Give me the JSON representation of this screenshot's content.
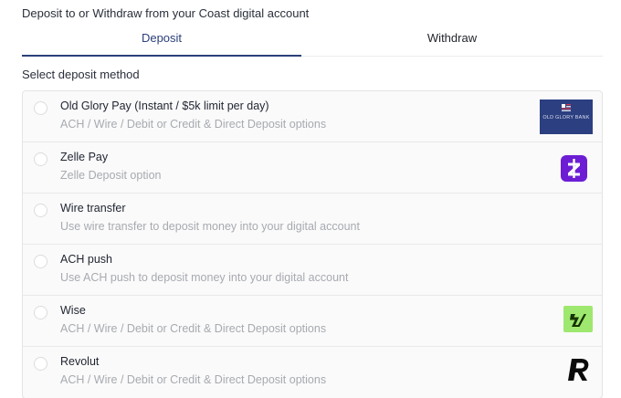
{
  "header": {
    "title": "Deposit to or Withdraw from your Coast digital account"
  },
  "tabs": [
    {
      "label": "Deposit",
      "active": true
    },
    {
      "label": "Withdraw",
      "active": false
    }
  ],
  "section": {
    "label": "Select deposit method"
  },
  "methods": [
    {
      "name": "Old Glory Pay (Instant / $5k limit per day)",
      "description": "ACH / Wire / Debit or Credit & Direct Deposit options",
      "logo": "old-glory-bank-logo",
      "logo_text": "OLD GLORY BANK",
      "selected": false
    },
    {
      "name": "Zelle Pay",
      "description": "Zelle Deposit option",
      "logo": "zelle-logo",
      "selected": false
    },
    {
      "name": "Wire transfer",
      "description": "Use wire transfer to deposit money into your digital account",
      "logo": "",
      "selected": false
    },
    {
      "name": "ACH push",
      "description": "Use ACH push to deposit money into your digital account",
      "logo": "",
      "selected": false
    },
    {
      "name": "Wise",
      "description": "ACH / Wire / Debit or Credit & Direct Deposit options",
      "logo": "wise-logo",
      "selected": false
    },
    {
      "name": "Revolut",
      "description": "ACH / Wire / Debit or Credit & Direct Deposit options",
      "logo": "revolut-logo",
      "selected": false
    }
  ],
  "colors": {
    "accent": "#2b3f7a",
    "zelle": "#6d1ed4",
    "wise": "#9fe870",
    "old_glory": "#2c3f80"
  }
}
